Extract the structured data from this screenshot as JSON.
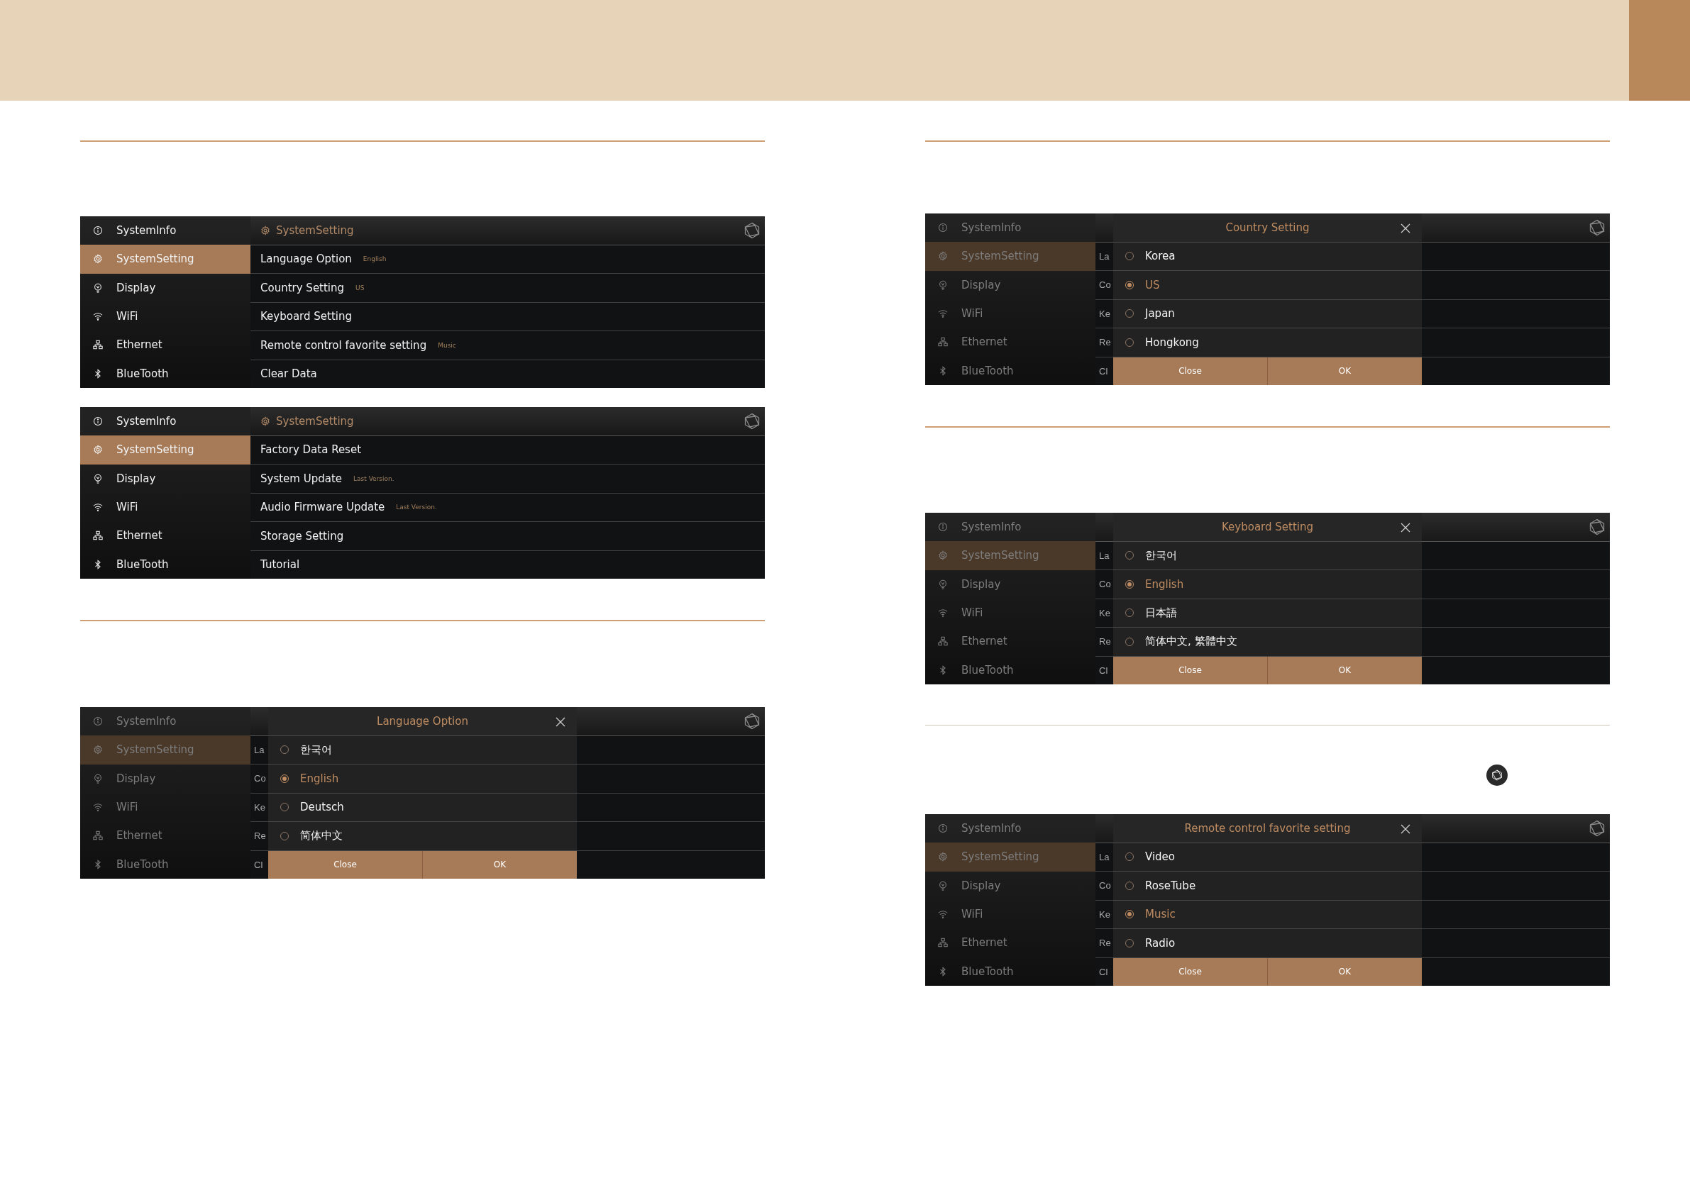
{
  "panels": [
    {
      "kind": "menu",
      "sidebar": [
        {
          "label": "SystemInfo",
          "selected": false
        },
        {
          "label": "SystemSetting",
          "selected": true
        },
        {
          "label": "Display",
          "selected": false
        },
        {
          "label": "WiFi",
          "selected": false
        },
        {
          "label": "Ethernet",
          "selected": false
        },
        {
          "label": "BlueTooth",
          "selected": false
        }
      ],
      "header": {
        "title": "SystemSetting"
      },
      "rows": [
        {
          "label": "Language Option",
          "value": "English"
        },
        {
          "label": "Country Setting",
          "value": "US"
        },
        {
          "label": "Keyboard Setting"
        },
        {
          "label": "Remote control favorite setting",
          "value": "Music"
        },
        {
          "label": "Clear Data"
        }
      ]
    },
    {
      "kind": "menu",
      "sidebar": [
        {
          "label": "SystemInfo",
          "selected": false
        },
        {
          "label": "SystemSetting",
          "selected": true
        },
        {
          "label": "Display",
          "selected": false
        },
        {
          "label": "WiFi",
          "selected": false
        },
        {
          "label": "Ethernet",
          "selected": false
        },
        {
          "label": "BlueTooth",
          "selected": false
        }
      ],
      "header": {
        "title": "SystemSetting"
      },
      "rows": [
        {
          "label": "Factory Data Reset"
        },
        {
          "label": "System Update",
          "value": "Last Version."
        },
        {
          "label": "Audio Firmware Update",
          "value": "Last Version."
        },
        {
          "label": "Storage Setting"
        },
        {
          "label": "Tutorial"
        }
      ]
    },
    {
      "kind": "dialog",
      "sidebar": [
        {
          "label": "SystemInfo",
          "selected": false
        },
        {
          "label": "SystemSetting",
          "selected": true
        },
        {
          "label": "Display",
          "selected": false
        },
        {
          "label": "WiFi",
          "selected": false
        },
        {
          "label": "Ethernet",
          "selected": false
        },
        {
          "label": "BlueTooth",
          "selected": false
        }
      ],
      "rows": [
        {
          "label": "La"
        },
        {
          "label": "Co"
        },
        {
          "label": "Ke"
        },
        {
          "label": "Re"
        },
        {
          "label": "Cl"
        }
      ],
      "dialog": {
        "title": "Language Option",
        "options": [
          {
            "label": "한국어",
            "selected": false
          },
          {
            "label": "English",
            "selected": true
          },
          {
            "label": "Deutsch",
            "selected": false
          },
          {
            "label": "简体中文",
            "selected": false
          }
        ],
        "buttons": [
          "Close",
          "OK"
        ]
      }
    },
    {
      "kind": "dialog",
      "sidebar": [
        {
          "label": "SystemInfo",
          "selected": false
        },
        {
          "label": "SystemSetting",
          "selected": true
        },
        {
          "label": "Display",
          "selected": false
        },
        {
          "label": "WiFi",
          "selected": false
        },
        {
          "label": "Ethernet",
          "selected": false
        },
        {
          "label": "BlueTooth",
          "selected": false
        }
      ],
      "rows": [
        {
          "label": "La"
        },
        {
          "label": "Co"
        },
        {
          "label": "Ke"
        },
        {
          "label": "Re"
        },
        {
          "label": "Cl"
        }
      ],
      "dialog": {
        "title": "Country Setting",
        "options": [
          {
            "label": "Korea",
            "selected": false
          },
          {
            "label": "US",
            "selected": true
          },
          {
            "label": "Japan",
            "selected": false
          },
          {
            "label": "Hongkong",
            "selected": false
          }
        ],
        "buttons": [
          "Close",
          "OK"
        ]
      }
    },
    {
      "kind": "dialog",
      "sidebar": [
        {
          "label": "SystemInfo",
          "selected": false
        },
        {
          "label": "SystemSetting",
          "selected": true
        },
        {
          "label": "Display",
          "selected": false
        },
        {
          "label": "WiFi",
          "selected": false
        },
        {
          "label": "Ethernet",
          "selected": false
        },
        {
          "label": "BlueTooth",
          "selected": false
        }
      ],
      "rows": [
        {
          "label": "La"
        },
        {
          "label": "Co"
        },
        {
          "label": "Ke"
        },
        {
          "label": "Re"
        },
        {
          "label": "Cl"
        }
      ],
      "dialog": {
        "title": "Keyboard Setting",
        "options": [
          {
            "label": "한국어",
            "selected": false
          },
          {
            "label": "English",
            "selected": true
          },
          {
            "label": "日本語",
            "selected": false
          },
          {
            "label": "简体中文, 繁體中文",
            "selected": false
          }
        ],
        "buttons": [
          "Close",
          "OK"
        ]
      }
    },
    {
      "kind": "dialog",
      "sidebar": [
        {
          "label": "SystemInfo",
          "selected": false
        },
        {
          "label": "SystemSetting",
          "selected": true
        },
        {
          "label": "Display",
          "selected": false
        },
        {
          "label": "WiFi",
          "selected": false
        },
        {
          "label": "Ethernet",
          "selected": false
        },
        {
          "label": "BlueTooth",
          "selected": false
        }
      ],
      "rows": [
        {
          "label": "La"
        },
        {
          "label": "Co"
        },
        {
          "label": "Ke"
        },
        {
          "label": "Re"
        },
        {
          "label": "Cl"
        }
      ],
      "dialog": {
        "title": "Remote control favorite setting",
        "options": [
          {
            "label": "Video",
            "selected": false
          },
          {
            "label": "RoseTube",
            "selected": false
          },
          {
            "label": "Music",
            "selected": true
          },
          {
            "label": "Radio",
            "selected": false
          }
        ],
        "buttons": [
          "Close",
          "OK"
        ]
      }
    }
  ]
}
